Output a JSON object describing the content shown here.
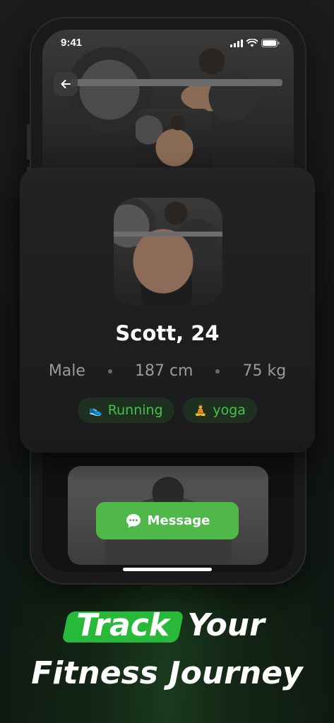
{
  "status_bar": {
    "time": "9:41",
    "icons": [
      "signal-icon",
      "wifi-icon",
      "battery-icon"
    ]
  },
  "profile": {
    "name": "Scott, 24",
    "gender": "Male",
    "height": "187 cm",
    "weight": "75 kg",
    "tags": [
      {
        "emoji": "👟",
        "label": "Running"
      },
      {
        "emoji": "🧘",
        "label": "yoga"
      }
    ]
  },
  "actions": {
    "message_label": "Message"
  },
  "headline": {
    "highlight_word": "Track",
    "line1_rest": "Your",
    "line2": "Fitness Journey"
  },
  "colors": {
    "accent_green": "#4fb848",
    "tag_text": "#46c24c",
    "tag_bg": "#1e3121"
  }
}
